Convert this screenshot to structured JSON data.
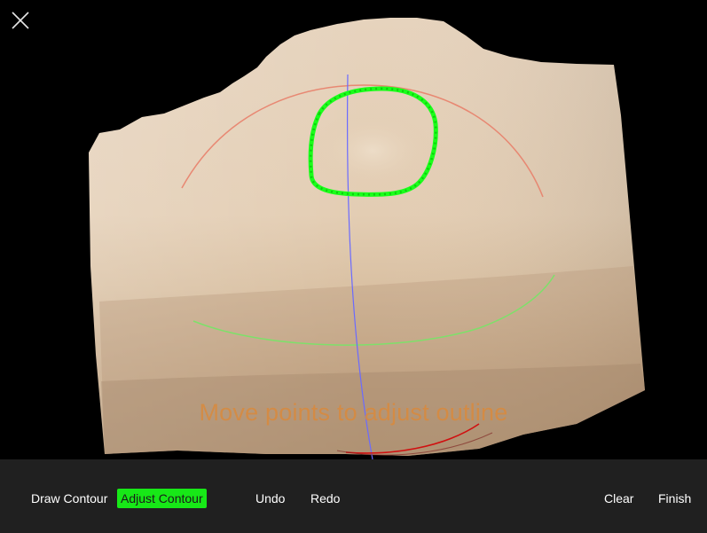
{
  "hint_text": "Move points to adjust outline",
  "toolbar": {
    "draw_contour": "Draw Contour",
    "adjust_contour": "Adjust Contour",
    "undo": "Undo",
    "redo": "Redo",
    "clear": "Clear",
    "finish": "Finish"
  },
  "active_mode": "Adjust Contour",
  "colors": {
    "accent_green": "#17e817",
    "toolbar_bg": "#202020",
    "hint": "#d98a3d",
    "arc_red": "#e8806a",
    "arc_green": "#7ee06a",
    "axis_blue": "#6a6aff",
    "arc_bottom_red": "#d01010"
  },
  "icons": {
    "close": "close-icon"
  }
}
